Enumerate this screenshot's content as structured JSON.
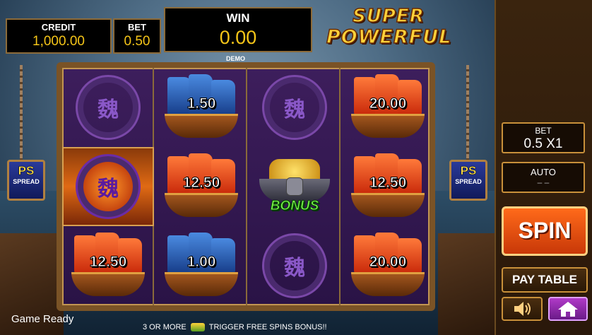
{
  "hud": {
    "credit_label": "CREDIT",
    "credit_value": "1,000.00",
    "bet_label": "BET",
    "bet_value": "0.50",
    "win_label": "WIN",
    "win_value": "0.00",
    "mode": "DEMO"
  },
  "logo": {
    "line1": "SUPER",
    "line2": "POWERFUL"
  },
  "reels": [
    [
      {
        "symbol": "wei",
        "glyph": "魏"
      },
      {
        "symbol": "wei",
        "glyph": "魏",
        "highlight": true
      },
      {
        "symbol": "ship-red",
        "amount": "12.50"
      }
    ],
    [
      {
        "symbol": "ship-blue",
        "amount": "1.50"
      },
      {
        "symbol": "ship-red",
        "amount": "12.50"
      },
      {
        "symbol": "ship-blue",
        "amount": "1.00"
      }
    ],
    [
      {
        "symbol": "wei",
        "glyph": "魏"
      },
      {
        "symbol": "bonus",
        "label": "BONUS"
      },
      {
        "symbol": "wei",
        "glyph": "魏"
      }
    ],
    [
      {
        "symbol": "ship-red",
        "amount": "20.00"
      },
      {
        "symbol": "ship-red",
        "amount": "12.50"
      },
      {
        "symbol": "ship-red",
        "amount": "20.00"
      }
    ]
  ],
  "ps_badge": {
    "top": "PS",
    "bottom": "SPREAD"
  },
  "status": "Game Ready",
  "ticker": {
    "left": "3 OR MORE",
    "right": "TRIGGER FREE SPINS BONUS!!"
  },
  "panel": {
    "bet_label": "BET",
    "bet_value": "0.5 X1",
    "auto_label": "AUTO",
    "auto_value": "– –",
    "spin_label": "SPIN",
    "paytable_label": "PAY TABLE"
  },
  "icons": {
    "sound": "speaker-icon",
    "home": "home-icon"
  },
  "colors": {
    "accent_gold": "#f5c518",
    "spin_orange": "#ff6a1a",
    "home_purple": "#b03ac8"
  }
}
